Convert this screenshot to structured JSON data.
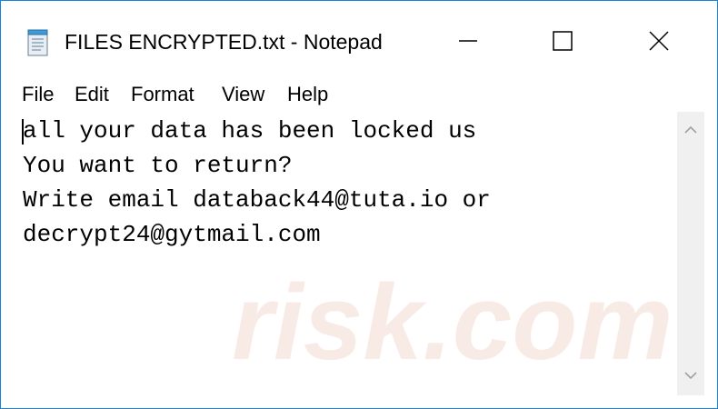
{
  "window": {
    "title": "FILES ENCRYPTED.txt - Notepad",
    "icon": "notepad-icon",
    "controls": {
      "minimize_icon": "minimize-icon",
      "maximize_icon": "maximize-icon",
      "close_icon": "close-icon"
    }
  },
  "menu": {
    "items": [
      "File",
      "Edit",
      "Format",
      "View",
      "Help"
    ]
  },
  "document": {
    "lines": [
      "all your data has been locked us",
      "You want to return?",
      "Write email databack44@tuta.io or",
      "decrypt24@gytmail.com"
    ]
  },
  "scrollbar": {
    "up_icon": "chevron-up-icon",
    "down_icon": "chevron-down-icon"
  },
  "watermark": {
    "text": "risk.com"
  },
  "colors": {
    "window_border": "#1883d7",
    "text": "#000000",
    "scrollbar_track": "#f0f0f0",
    "scroll_arrow": "#a0a0a0",
    "watermark": "#f3dcd3"
  }
}
